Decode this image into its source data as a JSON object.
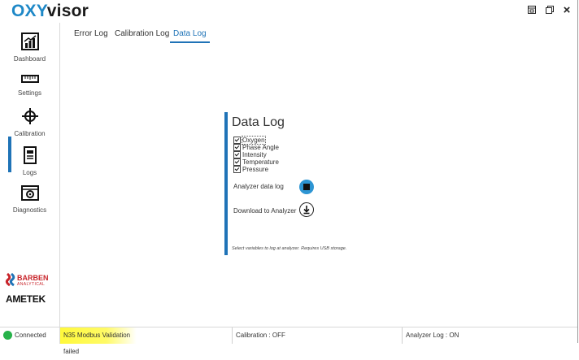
{
  "app": {
    "logo_part1": "OXY",
    "logo_part2": "visor",
    "window_controls": [
      "restore-icon",
      "minimize-icon",
      "close-icon"
    ],
    "close_label": "×"
  },
  "sidebar": {
    "items": [
      {
        "label": "Dashboard",
        "icon": "chart-icon"
      },
      {
        "label": "Settings",
        "icon": "ruler-icon"
      },
      {
        "label": "Calibration",
        "icon": "crosshair-icon"
      },
      {
        "label": "Logs",
        "icon": "document-icon",
        "active": true
      },
      {
        "label": "Diagnostics",
        "icon": "camera-icon"
      }
    ],
    "brand_barben": "BARBEN",
    "brand_barben_sub": "ANALYTICAL",
    "brand_ametek": "AMETEK"
  },
  "tabs": [
    {
      "label": "Error Log"
    },
    {
      "label": "Calibration Log"
    },
    {
      "label": "Data Log",
      "active": true
    }
  ],
  "panel": {
    "title": "Data Log",
    "variables": [
      {
        "label": "Oxygen",
        "checked": true
      },
      {
        "label": "Phase Angle",
        "checked": true
      },
      {
        "label": "Intensity",
        "checked": true
      },
      {
        "label": "Temperature",
        "checked": true
      },
      {
        "label": "Pressure",
        "checked": true
      }
    ],
    "analyzer_label": "Analyzer data log",
    "download_label": "Download to Analyzer",
    "hint": "Select variables to log at analyzer.  Requires USB storage."
  },
  "status": {
    "connection": "Connected",
    "alert": "N35 Modbus Validation failed",
    "calibration": "Calibration : OFF",
    "analyzer_log": "Analyzer Log : ON",
    "colors": {
      "connected": "#27b24a",
      "alert": "#fff93b",
      "accent": "#1f73b7"
    }
  }
}
